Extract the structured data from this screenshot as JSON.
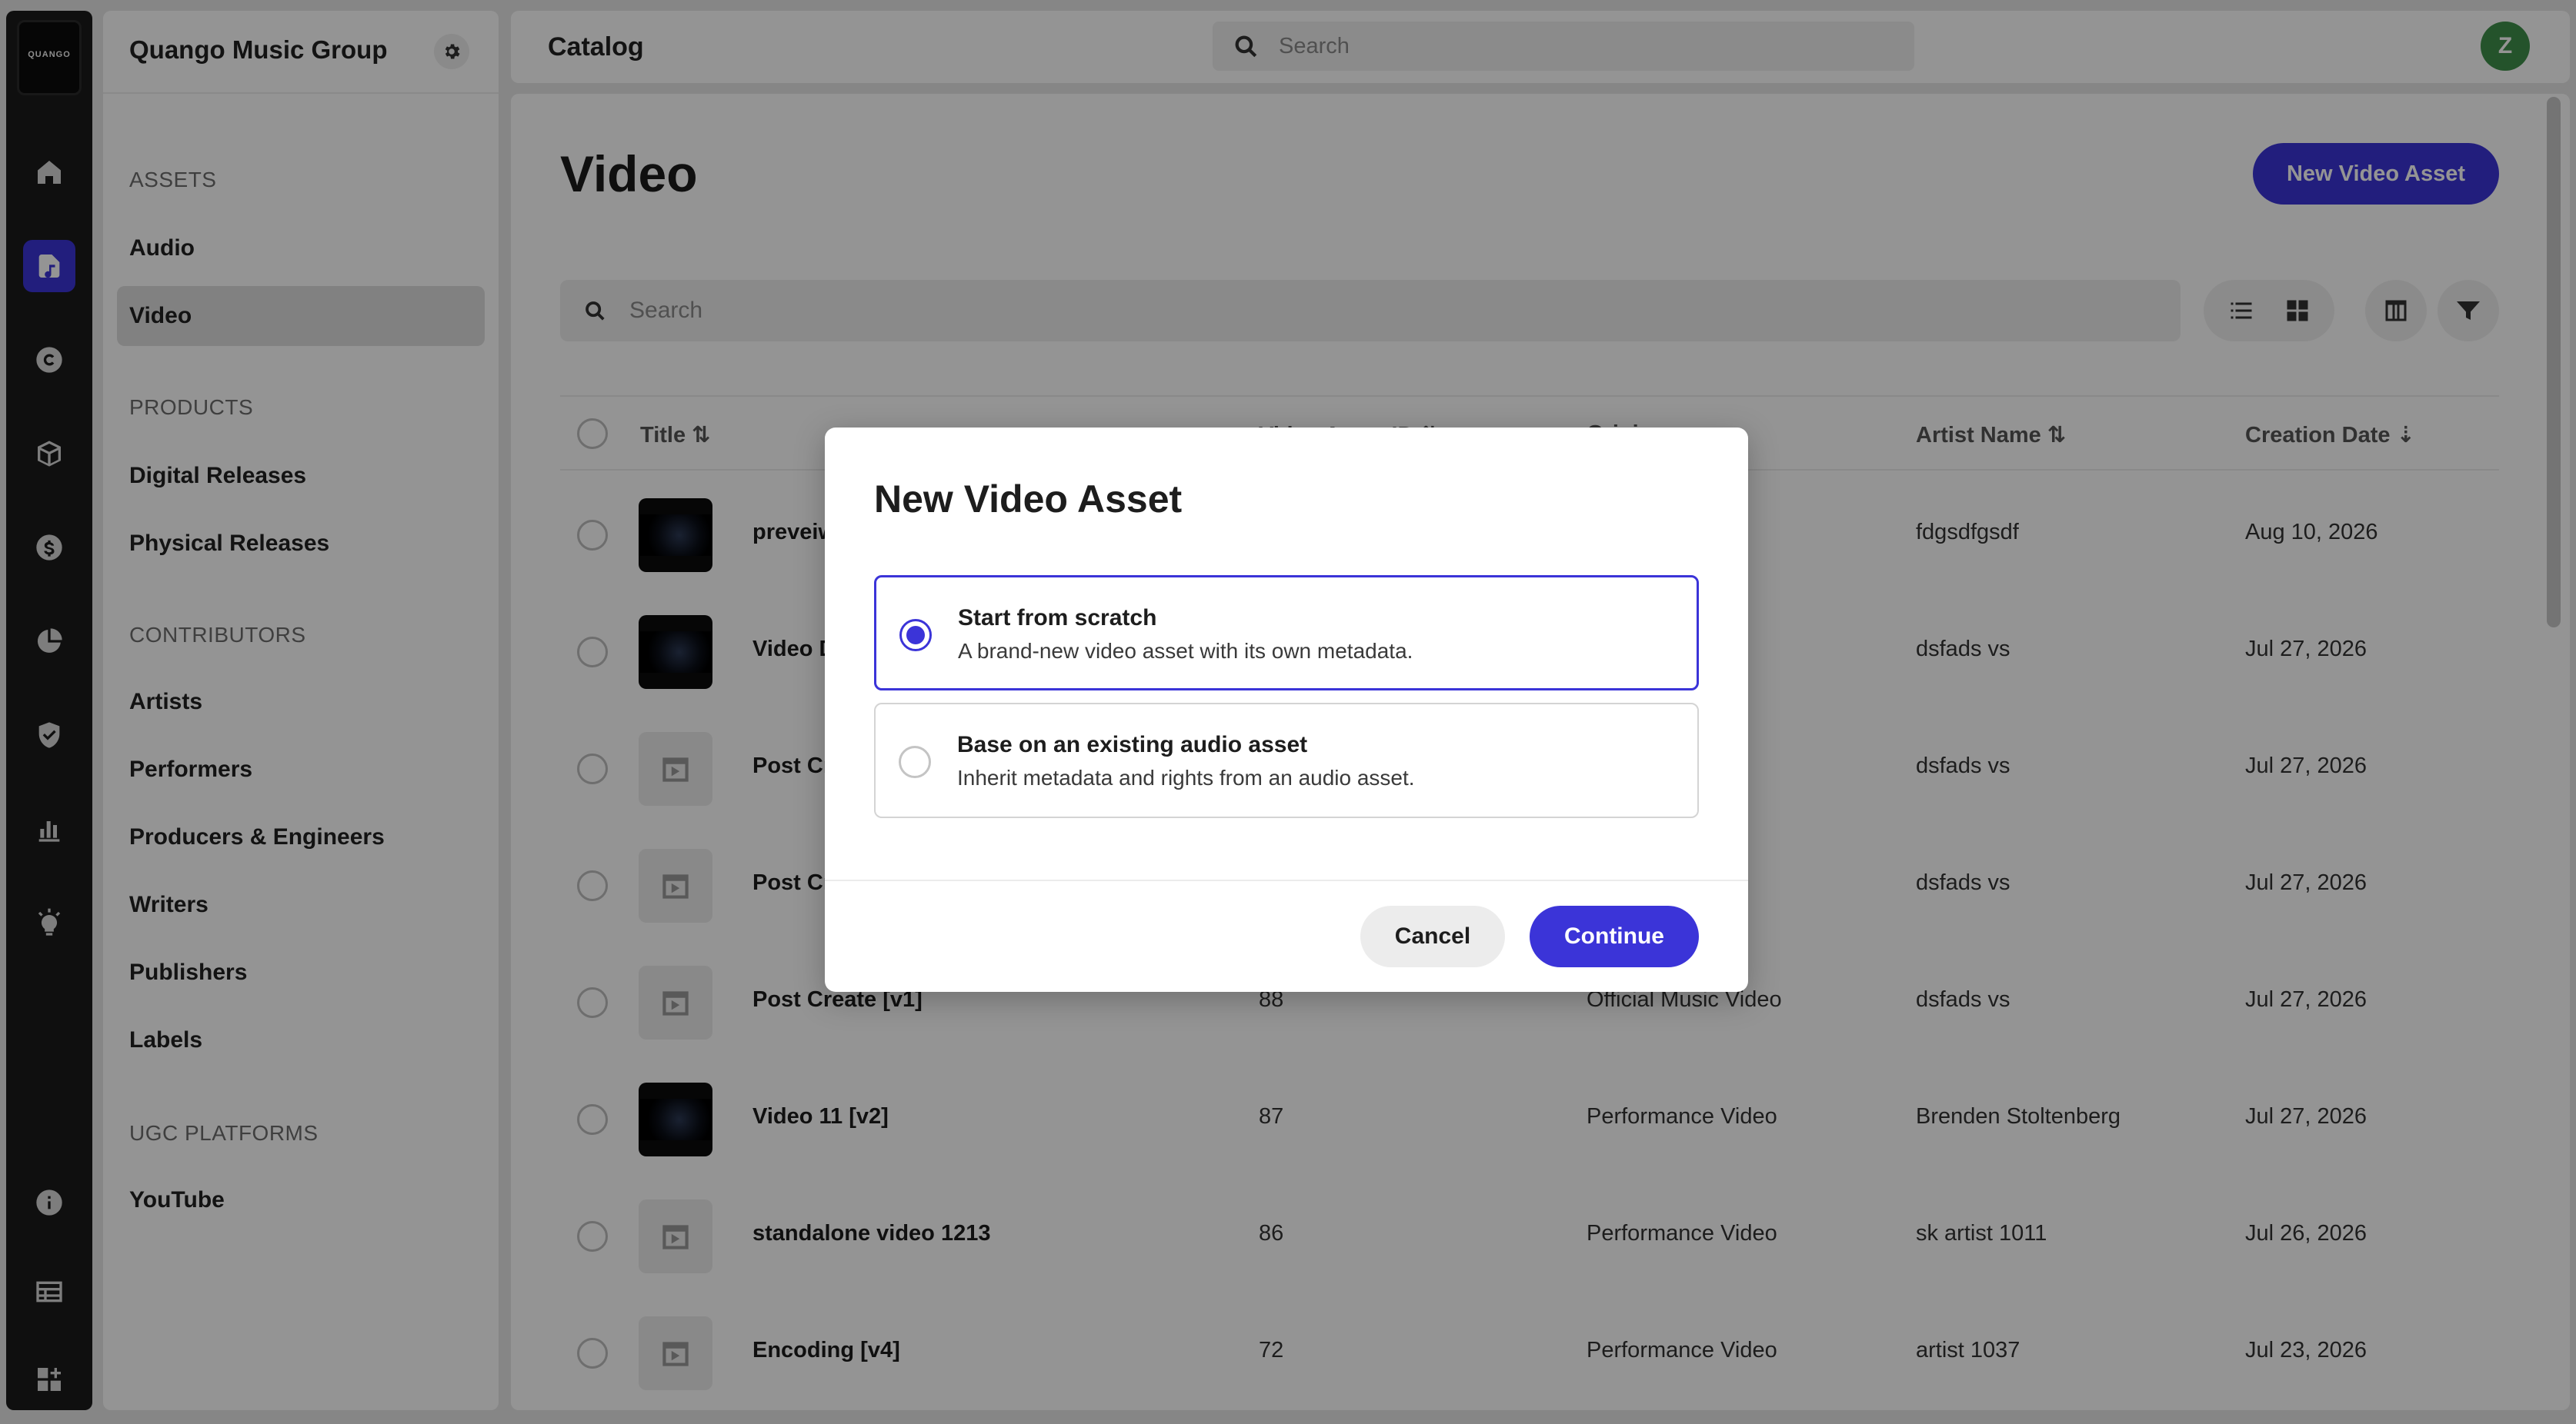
{
  "rail": {
    "logo_text": "QUANGO",
    "icons": [
      "home-icon",
      "music-file-icon",
      "copyright-icon",
      "box-icon",
      "dollar-icon",
      "pie-chart-icon",
      "shield-check-icon",
      "bar-chart-icon",
      "lightbulb-icon",
      "info-icon",
      "table-icon",
      "apps-add-icon"
    ],
    "active": "music-file-icon"
  },
  "sidebar": {
    "org_name": "Quango Music Group",
    "sections": [
      {
        "label": "ASSETS",
        "items": [
          "Audio",
          "Video"
        ]
      },
      {
        "label": "PRODUCTS",
        "items": [
          "Digital Releases",
          "Physical Releases"
        ]
      },
      {
        "label": "CONTRIBUTORS",
        "items": [
          "Artists",
          "Performers",
          "Producers & Engineers",
          "Writers",
          "Publishers",
          "Labels"
        ]
      },
      {
        "label": "UGC PLATFORMS",
        "items": [
          "YouTube"
        ]
      }
    ],
    "active_item": "Video"
  },
  "header": {
    "breadcrumb": "Catalog",
    "search_placeholder": "Search",
    "avatar_initial": "Z",
    "avatar_color": "#3f8f4a"
  },
  "main": {
    "title": "Video",
    "new_button": "New Video Asset",
    "search_placeholder": "Search",
    "columns": [
      "Title",
      "Video Asset ID",
      "Origin",
      "Artist Name",
      "Creation Date"
    ],
    "rows": [
      {
        "title": "preveiwS",
        "id": "",
        "origin": "",
        "artist": "fdgsdfgsdf",
        "date": "Aug 10, 2026",
        "thumb": "video"
      },
      {
        "title": "Video De",
        "id": "",
        "origin": "",
        "artist": "dsfads vs",
        "date": "Jul 27, 2026",
        "thumb": "video"
      },
      {
        "title": "Post Cre",
        "id": "",
        "origin": "",
        "artist": "dsfads vs",
        "date": "Jul 27, 2026",
        "thumb": "placeholder"
      },
      {
        "title": "Post Cre",
        "id": "",
        "origin": "",
        "artist": "dsfads vs",
        "date": "Jul 27, 2026",
        "thumb": "placeholder"
      },
      {
        "title": "Post Create [v1]",
        "id": "88",
        "origin": "Official Music Video",
        "artist": "dsfads vs",
        "date": "Jul 27, 2026",
        "thumb": "placeholder"
      },
      {
        "title": "Video 11 [v2]",
        "id": "87",
        "origin": "Performance Video",
        "artist": "Brenden Stoltenberg",
        "date": "Jul 27, 2026",
        "thumb": "video"
      },
      {
        "title": "standalone video 1213",
        "id": "86",
        "origin": "Performance Video",
        "artist": "sk artist 1011",
        "date": "Jul 26, 2026",
        "thumb": "placeholder"
      },
      {
        "title": "Encoding [v4]",
        "id": "72",
        "origin": "Performance Video",
        "artist": "artist 1037",
        "date": "Jul 23, 2026",
        "thumb": "placeholder"
      }
    ]
  },
  "modal": {
    "title": "New Video Asset",
    "options": [
      {
        "title": "Start from scratch",
        "description": "A brand-new video asset with its own metadata.",
        "selected": true
      },
      {
        "title": "Base on an existing audio asset",
        "description": "Inherit metadata and rights from an audio asset.",
        "selected": false
      }
    ],
    "cancel_label": "Cancel",
    "continue_label": "Continue"
  },
  "colors": {
    "accent": "#3b34d8",
    "rail_bg": "#1a1a1a"
  }
}
